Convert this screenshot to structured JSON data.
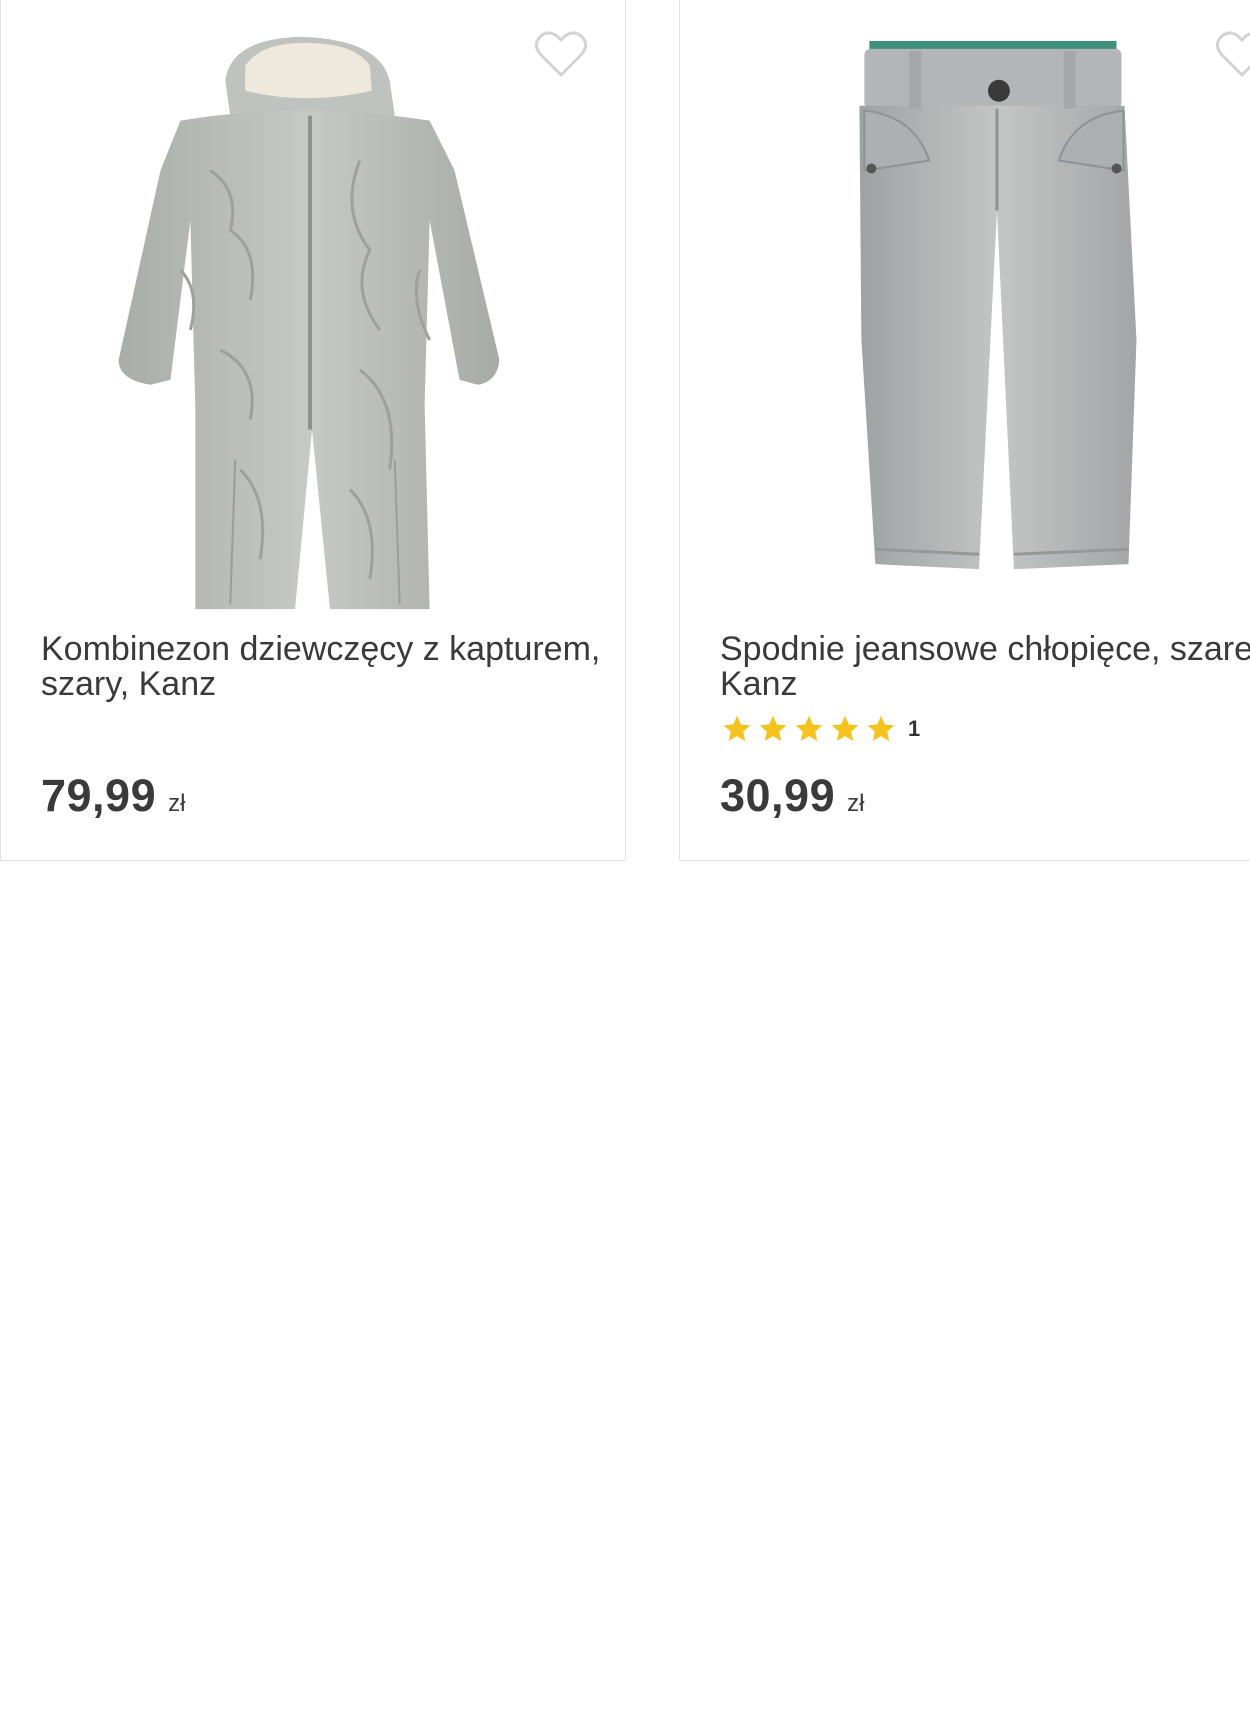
{
  "products": [
    {
      "title": "Kombinezon dziewczęcy z kapturem, szary, Kanz",
      "price": "79,99",
      "currency": "zł",
      "image_icon": "grey-hooded-snowsuit-image",
      "wishlist_icon": "heart-outline-icon"
    },
    {
      "title": "Spodnie jeansowe chłopięce, szare, Kanz",
      "price": "30,99",
      "currency": "zł",
      "rating_stars": 5,
      "rating_count": "1",
      "image_icon": "grey-jeans-image",
      "wishlist_icon": "heart-outline-icon"
    }
  ],
  "colors": {
    "star": "#f6c21c",
    "heart_outline": "#d3d3d3",
    "card_border": "#e3e3e3",
    "text": "#3a3a3a"
  }
}
